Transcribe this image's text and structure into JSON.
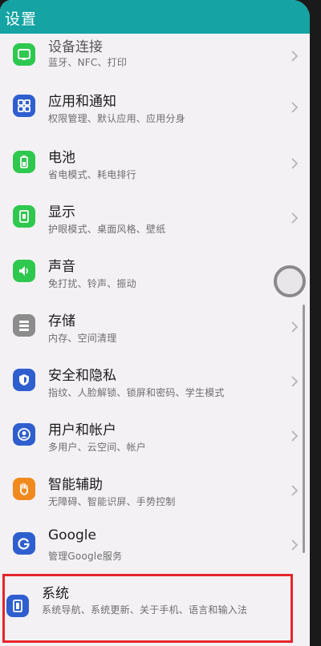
{
  "header": {
    "title": "设置"
  },
  "items": [
    {
      "title": "设备连接",
      "subtitle": "蓝牙、NFC、打印",
      "icon": "device-connection-icon",
      "color": "#2fc84f"
    },
    {
      "title": "应用和通知",
      "subtitle": "权限管理、默认应用、应用分身",
      "icon": "apps-icon",
      "color": "#2f5fcf"
    },
    {
      "title": "电池",
      "subtitle": "省电模式、耗电排行",
      "icon": "battery-icon",
      "color": "#2fc84f"
    },
    {
      "title": "显示",
      "subtitle": "护眼模式、桌面风格、壁纸",
      "icon": "display-icon",
      "color": "#2fc84f"
    },
    {
      "title": "声音",
      "subtitle": "免打扰、铃声、振动",
      "icon": "sound-icon",
      "color": "#2fc84f"
    },
    {
      "title": "存储",
      "subtitle": "内存、空间清理",
      "icon": "storage-icon",
      "color": "#8c8c8c"
    },
    {
      "title": "安全和隐私",
      "subtitle": "指纹、人脸解锁、锁屏和密码、学生模式",
      "icon": "security-icon",
      "color": "#2f5fcf"
    },
    {
      "title": "用户和帐户",
      "subtitle": "多用户、云空间、帐户",
      "icon": "user-account-icon",
      "color": "#2f5fcf"
    },
    {
      "title": "智能辅助",
      "subtitle": "无障碍、智能识屏、手势控制",
      "icon": "accessibility-icon",
      "color": "#f08a1e"
    },
    {
      "title": "Google",
      "subtitle": "管理Google服务",
      "icon": "google-icon",
      "color": "#2f5fcf"
    },
    {
      "title": "系统",
      "subtitle": "系统导航、系统更新、关于手机、语言和输入法",
      "icon": "system-icon",
      "color": "#2f5fcf"
    }
  ]
}
